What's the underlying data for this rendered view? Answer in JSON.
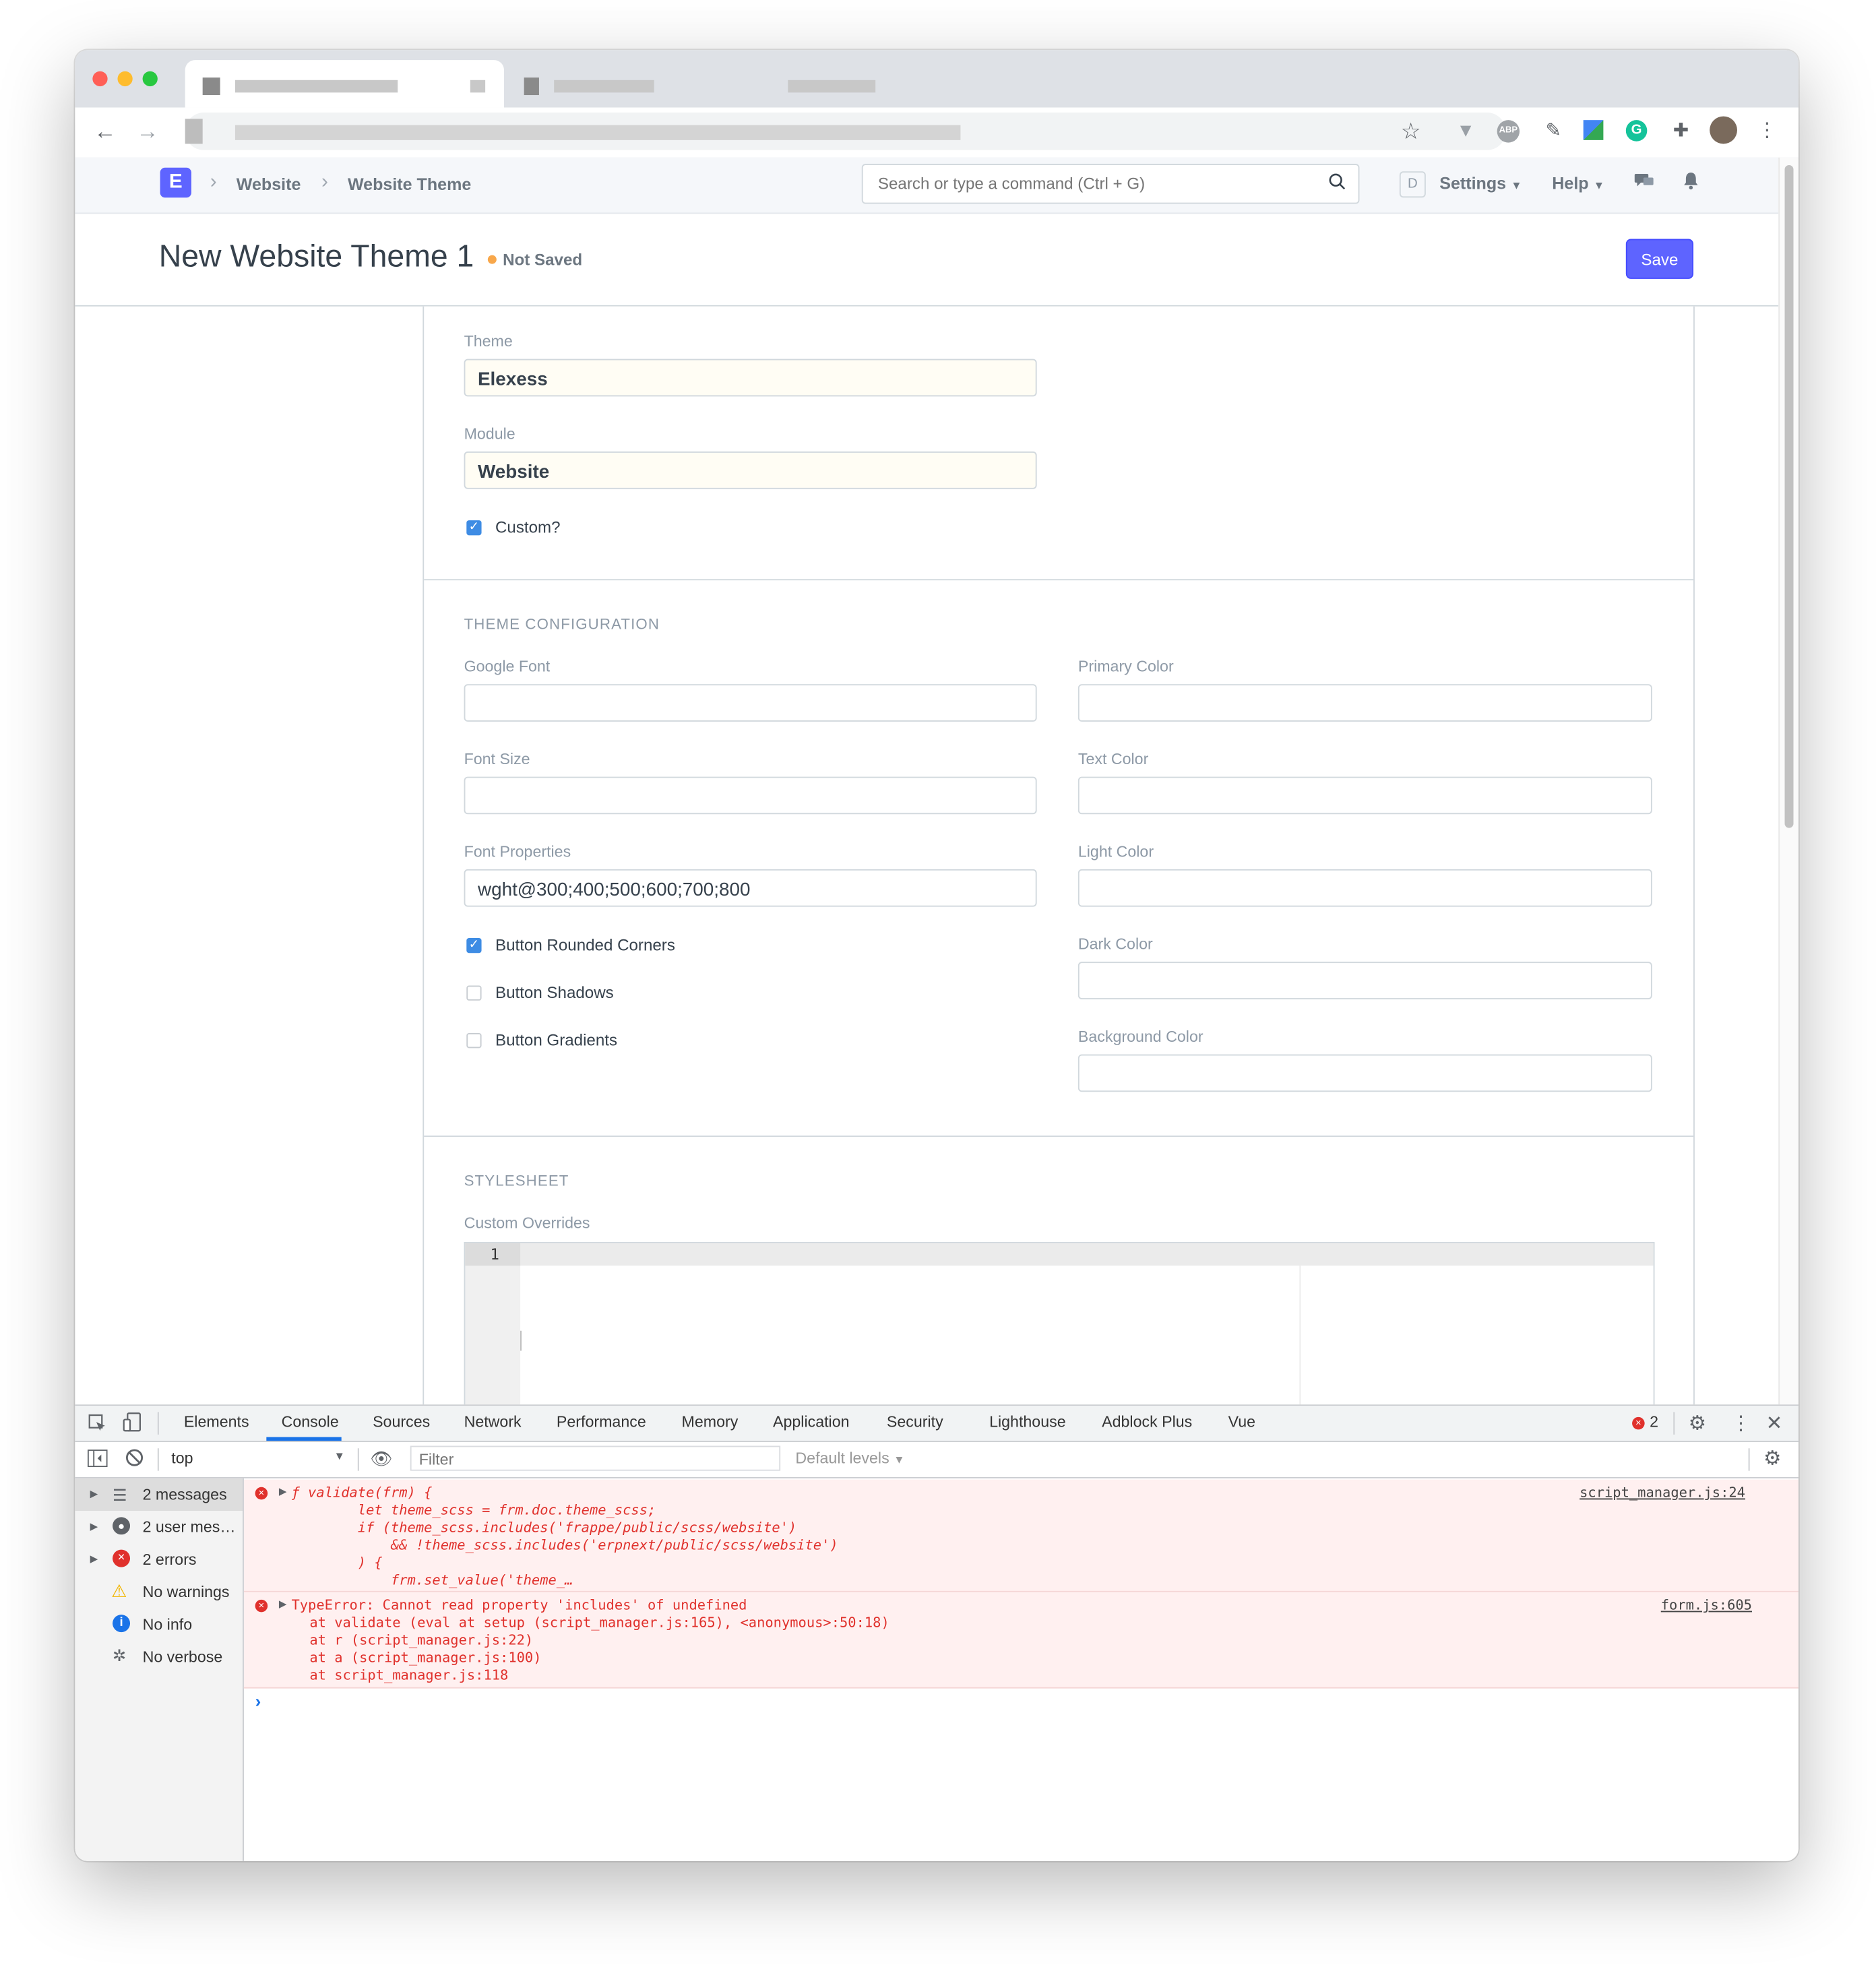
{
  "app": {
    "logo_letter": "E",
    "breadcrumb": [
      "Website",
      "Website Theme"
    ],
    "search_placeholder": "Search or type a command (Ctrl + G)",
    "avatar_letter": "D",
    "settings_label": "Settings",
    "help_label": "Help"
  },
  "page": {
    "title": "New Website Theme 1",
    "status": "Not Saved",
    "save_label": "Save"
  },
  "form": {
    "theme_label": "Theme",
    "theme_value": "Elexess",
    "module_label": "Module",
    "module_value": "Website",
    "custom_label": "Custom?",
    "custom_checked": true,
    "section_theme_config": "THEME CONFIGURATION",
    "google_font_label": "Google Font",
    "font_size_label": "Font Size",
    "font_properties_label": "Font Properties",
    "font_properties_value": "wght@300;400;500;600;700;800",
    "button_rounded_label": "Button Rounded Corners",
    "button_rounded_checked": true,
    "button_shadows_label": "Button Shadows",
    "button_shadows_checked": false,
    "button_gradients_label": "Button Gradients",
    "button_gradients_checked": false,
    "primary_color_label": "Primary Color",
    "text_color_label": "Text Color",
    "light_color_label": "Light Color",
    "dark_color_label": "Dark Color",
    "background_color_label": "Background Color",
    "section_stylesheet": "STYLESHEET",
    "custom_overrides_label": "Custom Overrides",
    "editor_line_number": "1"
  },
  "devtools": {
    "tabs": [
      "Elements",
      "Console",
      "Sources",
      "Network",
      "Performance",
      "Memory",
      "Application",
      "Security",
      "Lighthouse",
      "Adblock Plus",
      "Vue"
    ],
    "active_tab": "Console",
    "error_count": "2",
    "context": "top",
    "filter_placeholder": "Filter",
    "levels_label": "Default levels",
    "sidebar": [
      "2 messages",
      "2 user mes…",
      "2 errors",
      "No warnings",
      "No info",
      "No verbose"
    ],
    "messages": [
      {
        "lines": [
          "ƒ validate(frm) {",
          "        let theme_scss = frm.doc.theme_scss;",
          "        if (theme_scss.includes('frappe/public/scss/website')",
          "            && !theme_scss.includes('erpnext/public/scss/website')",
          "        ) {",
          "            frm.set_value('theme_…"
        ],
        "source": "script_manager.js:24"
      },
      {
        "lines": [
          "TypeError: Cannot read property 'includes' of undefined",
          "    at validate (eval at setup (script_manager.js:165), <anonymous>:50:18)",
          "    at r (script_manager.js:22)",
          "    at a (script_manager.js:100)",
          "    at script_manager.js:118"
        ],
        "source": "form.js:605"
      }
    ],
    "prompt": "›"
  },
  "colors": {
    "accent": "#5e64ff",
    "status_dot": "#f8a74a",
    "error_red": "#e0312c",
    "checkbox_blue": "#3e8ce4"
  },
  "icons": [
    "back-icon",
    "forward-icon",
    "star-icon",
    "extension-icon",
    "search-icon",
    "bell-icon",
    "chat-icon",
    "settings-gear-icon",
    "close-icon",
    "kebab-icon"
  ]
}
